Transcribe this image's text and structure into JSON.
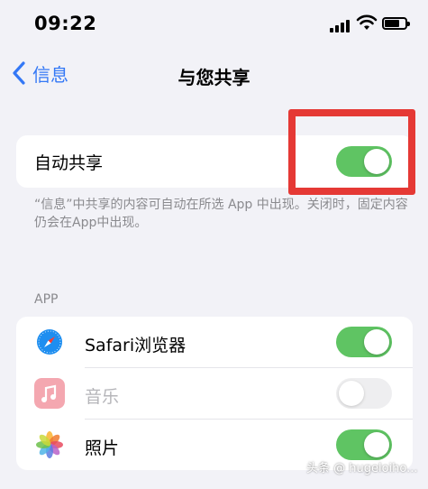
{
  "status_bar": {
    "time": "09:22",
    "icons": [
      "cellular-signal-icon",
      "wifi-icon",
      "battery-icon"
    ]
  },
  "nav": {
    "back_label": "信息",
    "title": "与您共享"
  },
  "auto_share": {
    "label": "自动共享",
    "enabled": true
  },
  "footnote": "“信息”中共享的内容可自动在所选 App 中出现。关闭时，固定内容仍会在App中出现。",
  "apps_section": {
    "header": "APP",
    "items": [
      {
        "name": "Safari浏览器",
        "icon": "safari-icon",
        "enabled": true,
        "dimmed": false
      },
      {
        "name": "音乐",
        "icon": "music-icon",
        "enabled": false,
        "dimmed": true
      },
      {
        "name": "照片",
        "icon": "photos-icon",
        "enabled": true,
        "dimmed": false
      }
    ]
  },
  "watermark": "头条 @ hugeloiho...",
  "colors": {
    "accent_blue": "#3478f6",
    "toggle_on": "#5fc463",
    "toggle_off": "#e8e8ea",
    "highlight_red": "#e53935",
    "background": "#f2f2f7"
  }
}
